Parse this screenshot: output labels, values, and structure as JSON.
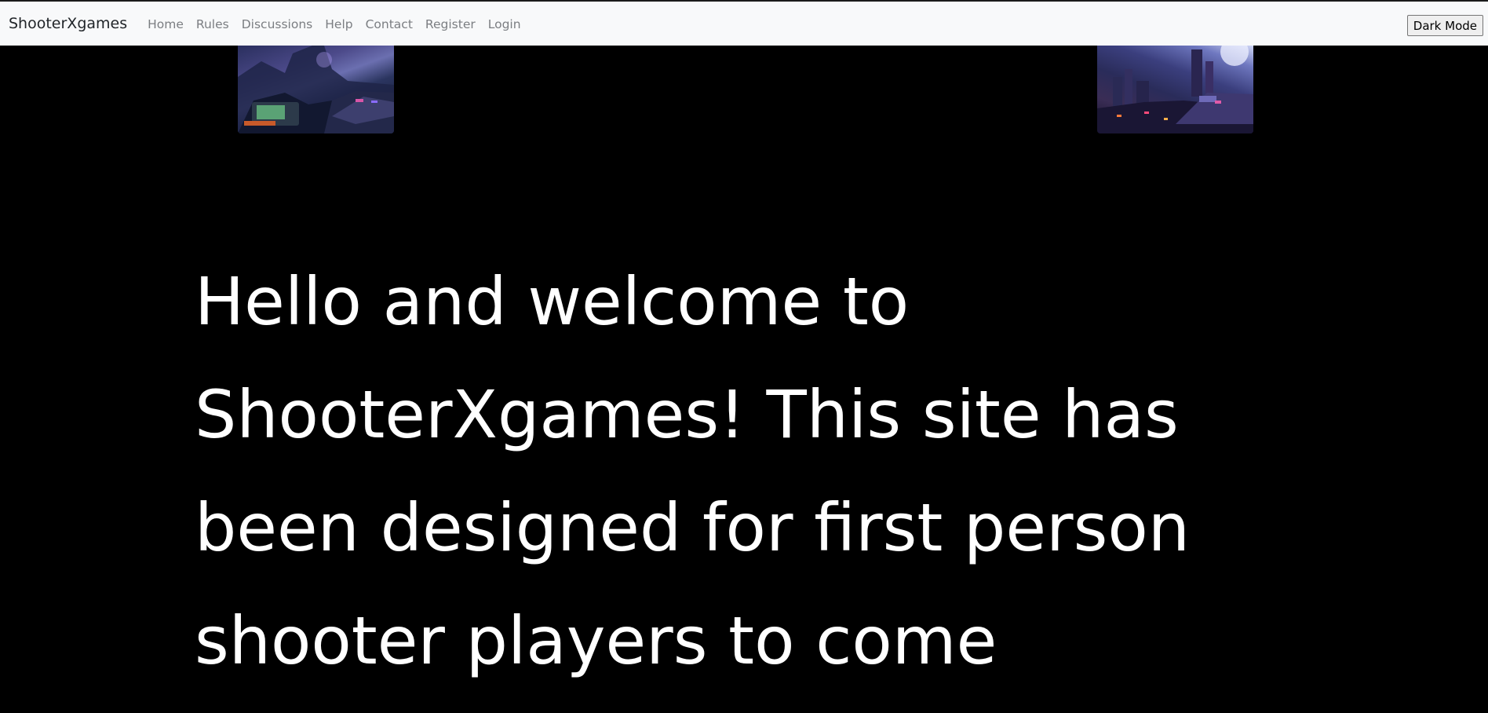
{
  "navbar": {
    "brand": "ShooterXgames",
    "links": [
      "Home",
      "Rules",
      "Discussions",
      "Help",
      "Contact",
      "Register",
      "Login"
    ],
    "dark_mode_button": "Dark Mode"
  },
  "main": {
    "welcome_text": "Hello and welcome to ShooterXgames! This site has been designed for first person shooter players to come"
  },
  "colors": {
    "page_background": "#000000",
    "navbar_background": "#f8f9fa",
    "hero_text": "#ffffff",
    "nav_link": "#7b7e82"
  }
}
